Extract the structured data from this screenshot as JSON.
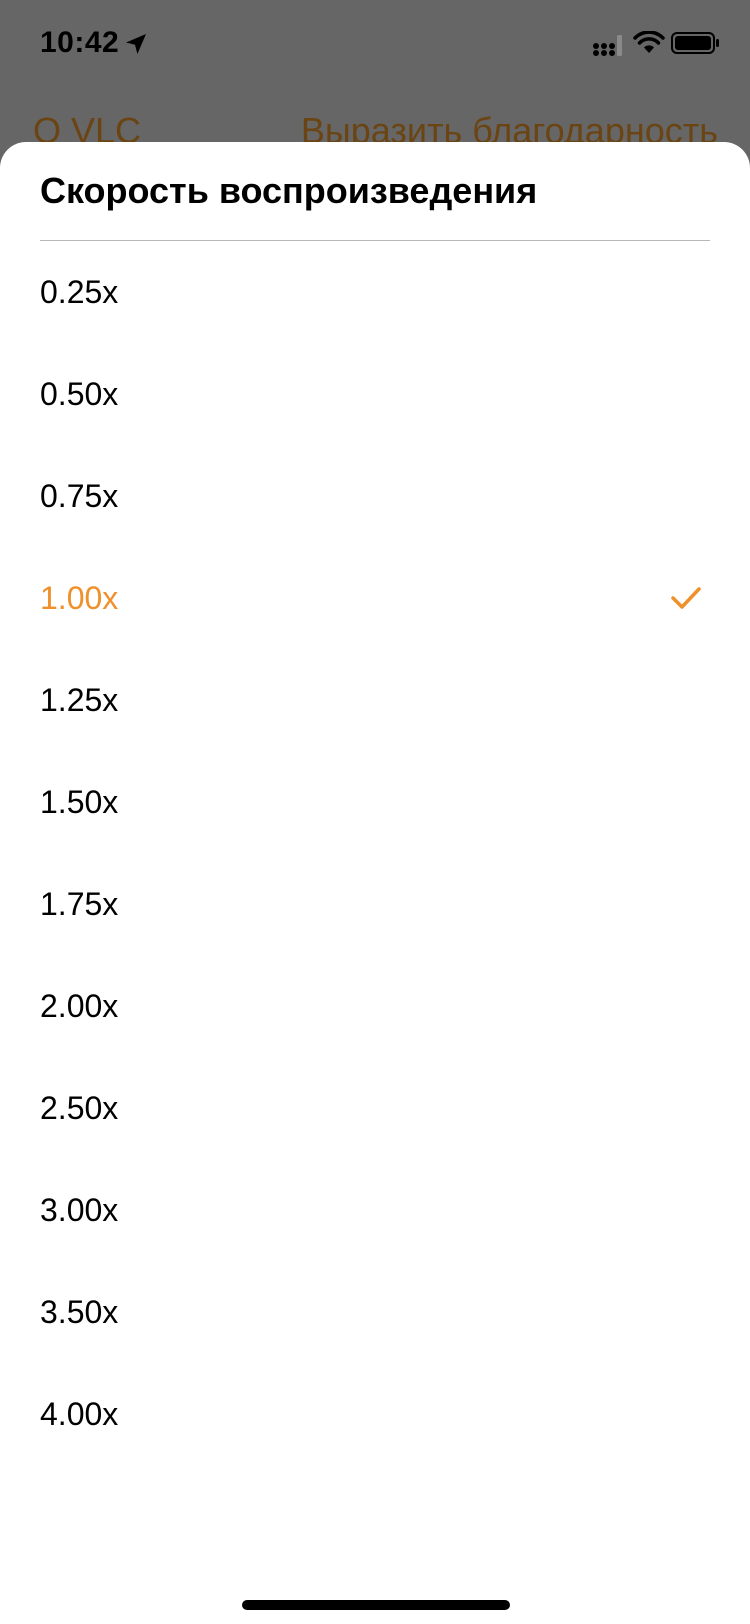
{
  "status_bar": {
    "time": "10:42",
    "icons": [
      "location-arrow-icon",
      "cellular-signal-icon",
      "wifi-icon",
      "battery-icon"
    ]
  },
  "nav": {
    "left_label": "О VLC",
    "right_label": "Выразить благодарность"
  },
  "sheet": {
    "title": "Скорость воспроизведения",
    "options": [
      {
        "label": "0.25x",
        "selected": false
      },
      {
        "label": "0.50x",
        "selected": false
      },
      {
        "label": "0.75x",
        "selected": false
      },
      {
        "label": "1.00x",
        "selected": true
      },
      {
        "label": "1.25x",
        "selected": false
      },
      {
        "label": "1.50x",
        "selected": false
      },
      {
        "label": "1.75x",
        "selected": false
      },
      {
        "label": "2.00x",
        "selected": false
      },
      {
        "label": "2.50x",
        "selected": false
      },
      {
        "label": "3.00x",
        "selected": false
      },
      {
        "label": "3.50x",
        "selected": false
      },
      {
        "label": "4.00x",
        "selected": false
      }
    ]
  },
  "colors": {
    "accent": "#f0902a",
    "dimmed_background": "#666666",
    "dimmed_nav_text": "#6b4413",
    "sheet_background": "#ffffff"
  }
}
